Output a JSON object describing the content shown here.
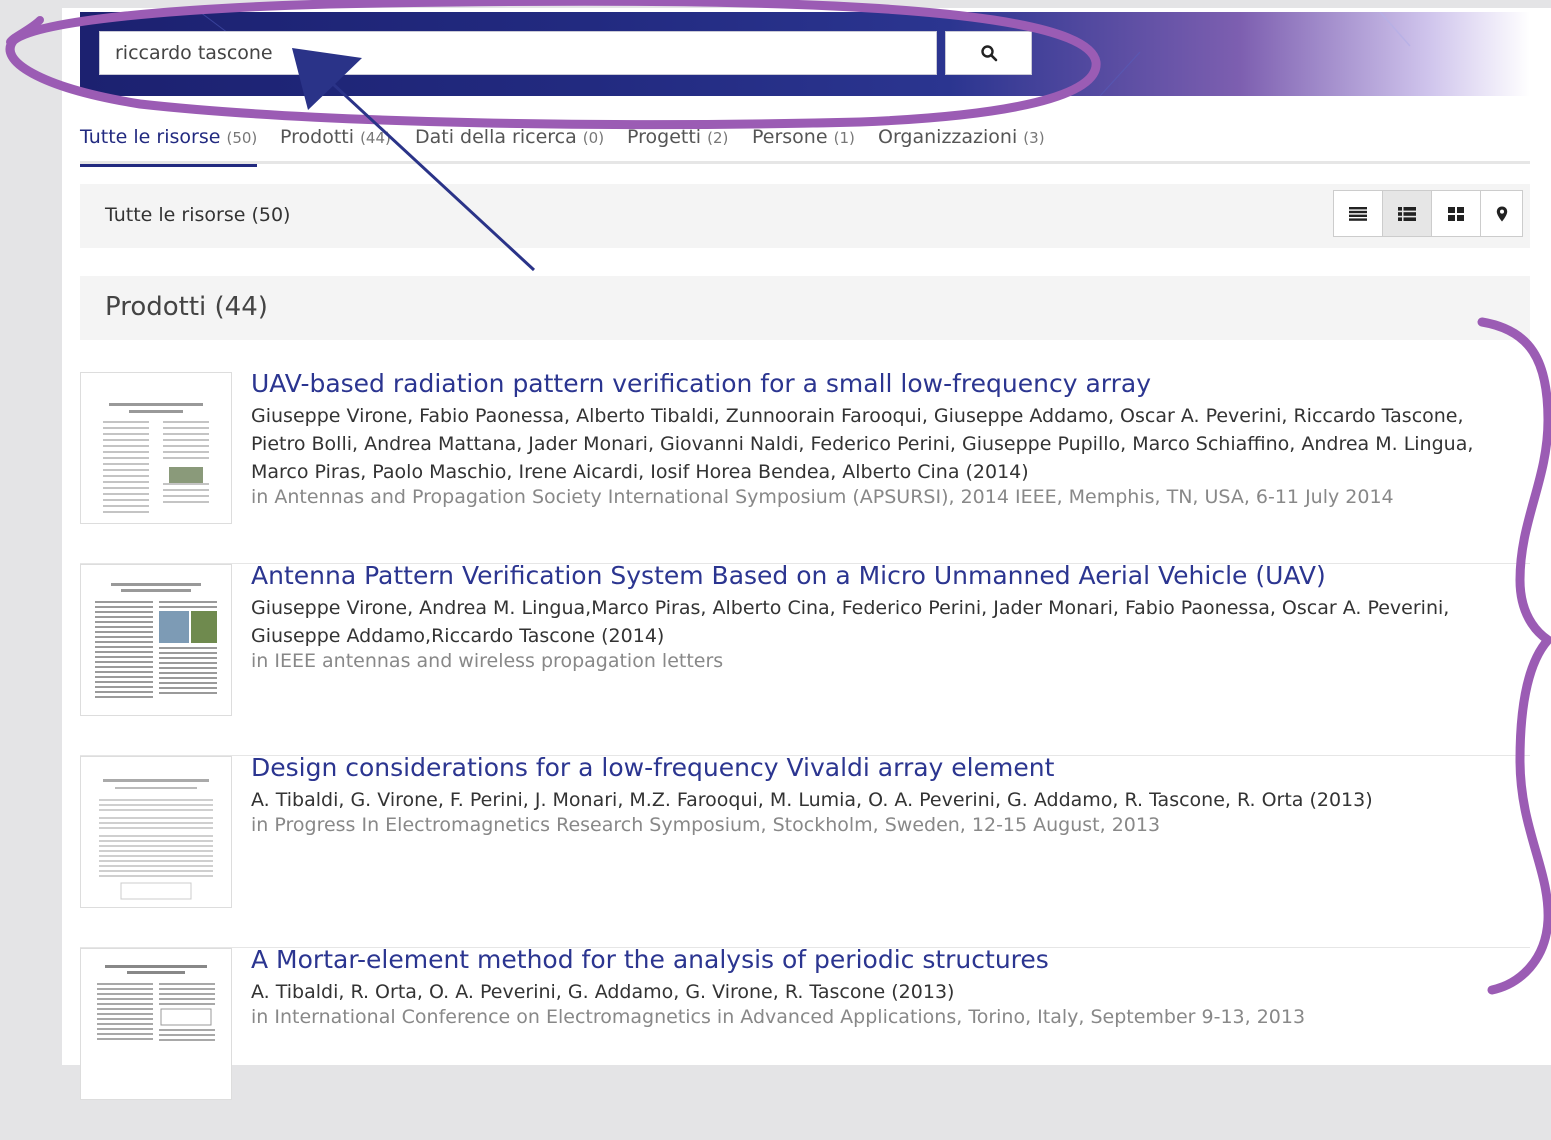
{
  "search": {
    "value": "riccardo tascone"
  },
  "tabs": [
    {
      "label": "Tutte le risorse",
      "count": "(50)"
    },
    {
      "label": "Prodotti",
      "count": "(44)"
    },
    {
      "label": "Dati della ricerca",
      "count": "(0)"
    },
    {
      "label": "Progetti",
      "count": "(2)"
    },
    {
      "label": "Persone",
      "count": "(1)"
    },
    {
      "label": "Organizzazioni",
      "count": "(3)"
    }
  ],
  "filter_bar": {
    "label": "Tutte le risorse (50)"
  },
  "section": {
    "title": "Prodotti (44)"
  },
  "results": [
    {
      "title": "UAV-based radiation pattern verification for a small low-frequency array",
      "authors": "Giuseppe Virone, Fabio Paonessa, Alberto Tibaldi, Zunnoorain Farooqui, Giuseppe Addamo, Oscar A. Peverini, Riccardo Tascone, Pietro Bolli, Andrea Mattana, Jader Monari, Giovanni Naldi, Federico Perini, Giuseppe Pupillo, Marco Schiaffino, Andrea M. Lingua, Marco Piras, Paolo Maschio, Irene Aicardi, Iosif Horea Bendea, Alberto Cina (2014)",
      "venue": "in Antennas and Propagation Society International Symposium (APSURSI), 2014 IEEE, Memphis, TN, USA, 6-11 July 2014"
    },
    {
      "title": "Antenna Pattern Verification System Based on a Micro Unmanned Aerial Vehicle (UAV)",
      "authors": "Giuseppe Virone, Andrea M. Lingua,Marco Piras, Alberto Cina, Federico Perini, Jader Monari, Fabio Paonessa, Oscar A. Peverini, Giuseppe Addamo,Riccardo Tascone (2014)",
      "venue": "in IEEE antennas and wireless propagation letters"
    },
    {
      "title": "Design considerations for a low-frequency Vivaldi array element",
      "authors": "A. Tibaldi, G. Virone, F. Perini, J. Monari, M.Z. Farooqui, M. Lumia, O. A. Peverini, G. Addamo, R. Tascone, R. Orta (2013)",
      "venue": "in Progress In Electromagnetics Research Symposium, Stockholm, Sweden, 12-15 August, 2013"
    },
    {
      "title": "A Mortar-element method for the analysis of periodic structures",
      "authors": "A. Tibaldi, R. Orta, O. A. Peverini, G. Addamo, G. Virone, R. Tascone (2013)",
      "venue": "in International Conference on Electromagnetics in Advanced Applications, Torino, Italy, September 9-13, 2013"
    }
  ],
  "colors": {
    "brand": "#222a80",
    "annotation": "#9b5cb4"
  },
  "icons": [
    "search-icon",
    "list-view-icon",
    "detailed-list-view-icon",
    "grid-view-icon",
    "map-pin-icon"
  ]
}
